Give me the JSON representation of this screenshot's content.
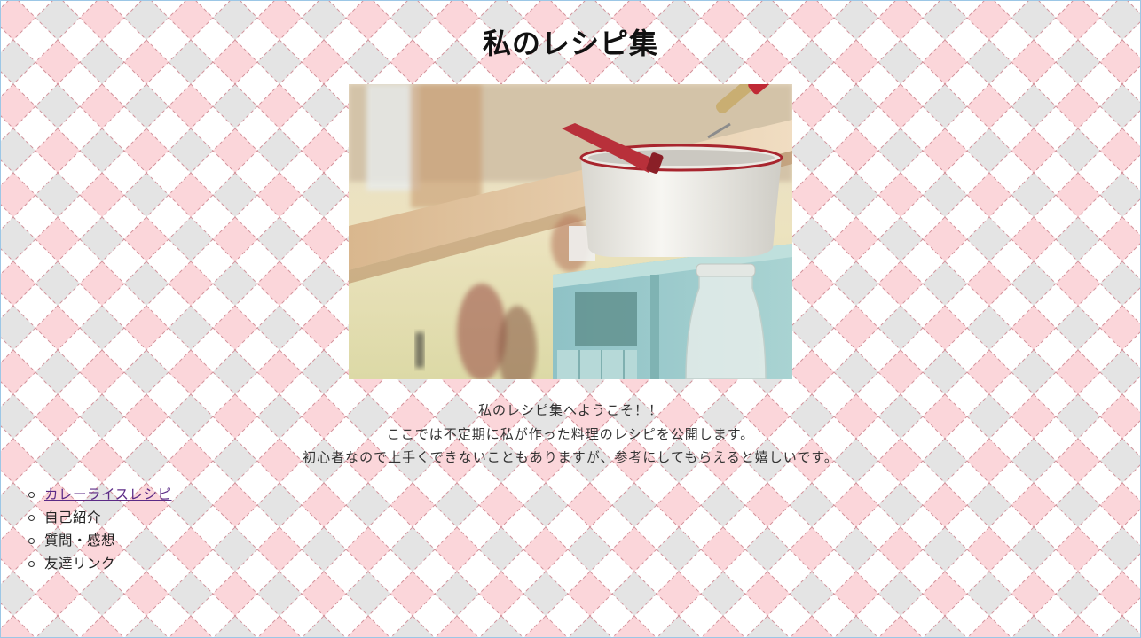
{
  "page": {
    "title": "私のレシピ集"
  },
  "hero_image": {
    "description_icon": "kitchen-photo"
  },
  "intro": {
    "lines": [
      "私のレシピ集へようこそ！！",
      "ここでは不定期に私が作った料理のレシピを公開します。",
      "初心者なので上手くできないこともありますが、参考にしてもらえると嬉しいです。"
    ]
  },
  "nav": {
    "items": [
      {
        "label": "カレーライスレシピ",
        "link": true
      },
      {
        "label": "自己紹介",
        "link": false
      },
      {
        "label": "質問・感想",
        "link": false
      },
      {
        "label": "友達リンク",
        "link": false
      }
    ]
  },
  "colors": {
    "pink_diamond": "#fbd6da",
    "gray_diamond": "#e4e4e4",
    "stitch": "#c97b86",
    "link": "#5b2a86"
  }
}
